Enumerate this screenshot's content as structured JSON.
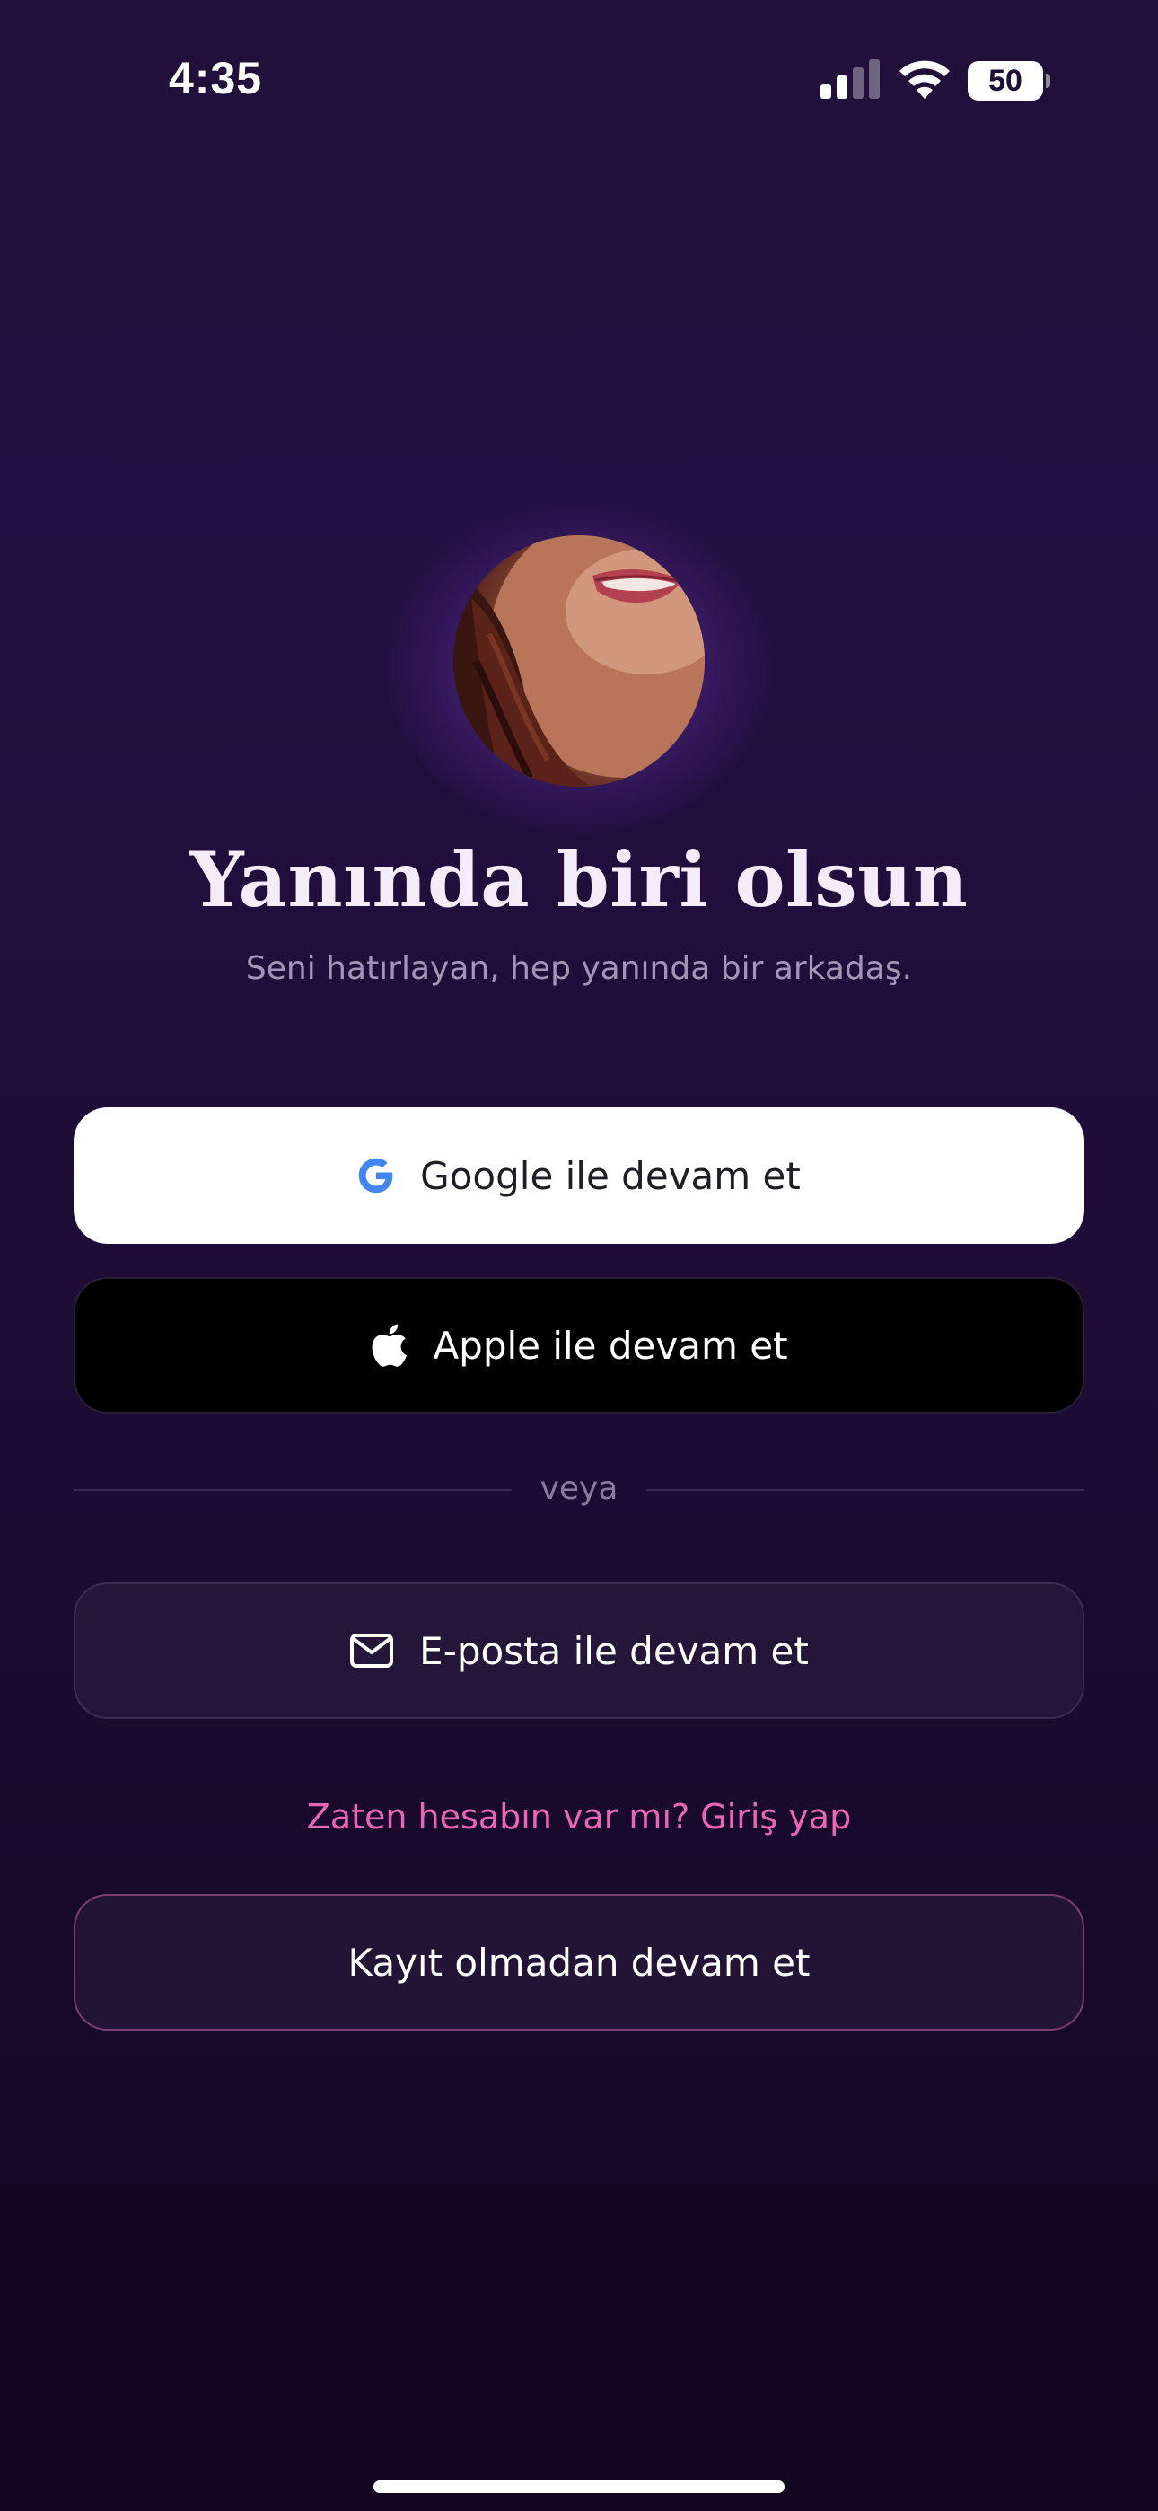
{
  "status_bar": {
    "time": "4:35",
    "battery": "50"
  },
  "avatar": {
    "icon": "avatar-photo"
  },
  "hero": {
    "title": "Yanında biri olsun",
    "subtitle": "Seni hatırlayan, hep yanında bir arkadaş."
  },
  "buttons": {
    "google": "Google ile devam et",
    "apple": "Apple ile devam et",
    "email": "E-posta ile devam et",
    "guest": "Kayıt olmadan devam et"
  },
  "divider": {
    "text": "veya"
  },
  "login_link": "Zaten hesabın var mı? Giriş yap",
  "colors": {
    "accent_pink": "#ec65b6",
    "background_top": "#22103a",
    "background_bottom": "#13061f",
    "google_blue": "#4285f4"
  }
}
